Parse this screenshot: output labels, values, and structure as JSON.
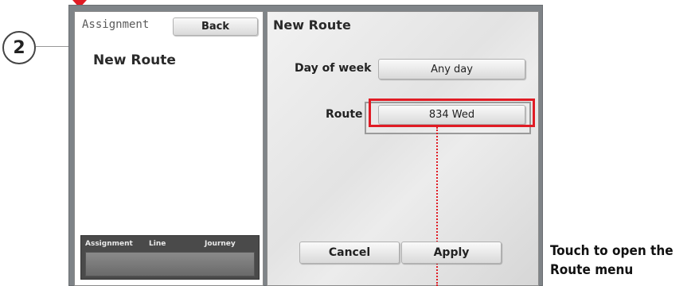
{
  "annotation": {
    "step_number": "2",
    "hint": "Touch to open the Route menu"
  },
  "left_panel": {
    "header_label": "Assignment",
    "back_label": "Back",
    "title": "New Route",
    "table_headers": [
      "Assignment",
      "Line",
      "Journey"
    ]
  },
  "right_panel": {
    "title": "New Route",
    "day_of_week_label": "Day of week",
    "day_of_week_value": "Any day",
    "route_label": "Route",
    "route_value": "834 Wed",
    "cancel_label": "Cancel",
    "apply_label": "Apply"
  },
  "colors": {
    "highlight": "#e01b24",
    "frame": "#7f8488"
  }
}
